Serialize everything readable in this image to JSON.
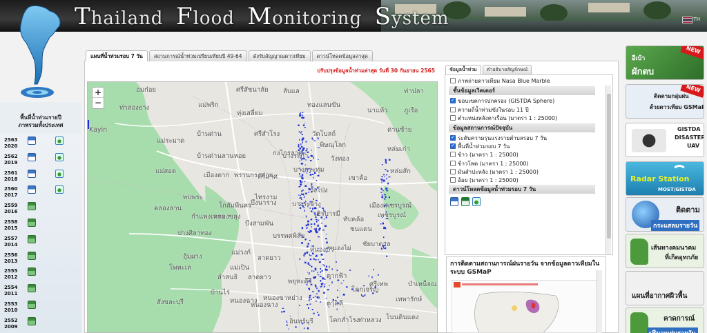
{
  "header": {
    "title_words": [
      {
        "cap": "T",
        "rest": "hailand"
      },
      {
        "cap": "F",
        "rest": "lood"
      },
      {
        "cap": "M",
        "rest": "onitoring"
      },
      {
        "cap": "S",
        "rest": "ystem"
      }
    ],
    "lang_label": "TH"
  },
  "left_panel": {
    "title_line1": "พื้นที่น้ำท่วมรายปี",
    "title_line2": "ภาพรวมทั้งประเทศ",
    "years": [
      {
        "th": "2563",
        "en": "2020",
        "icon1": "shp-icon",
        "icon2": "kmz-icon"
      },
      {
        "th": "2562",
        "en": "2019",
        "icon1": "shp-icon",
        "icon2": "kmz-icon"
      },
      {
        "th": "2561",
        "en": "2018",
        "icon1": "shp-icon",
        "icon2": "kmz-icon"
      },
      {
        "th": "2560",
        "en": "2017",
        "icon1": "shp-icon",
        "icon2": "kmz-icon"
      },
      {
        "th": "2559",
        "en": "2016",
        "icon1": "jpg-icon",
        "icon2": ""
      },
      {
        "th": "2558",
        "en": "2015",
        "icon1": "jpg-icon",
        "icon2": ""
      },
      {
        "th": "2557",
        "en": "2014",
        "icon1": "jpg-icon",
        "icon2": ""
      },
      {
        "th": "2556",
        "en": "2013",
        "icon1": "jpg-icon",
        "icon2": ""
      },
      {
        "th": "2555",
        "en": "2012",
        "icon1": "jpg-icon",
        "icon2": ""
      },
      {
        "th": "2554",
        "en": "2011",
        "icon1": "jpg-icon",
        "icon2": ""
      },
      {
        "th": "2553",
        "en": "2010",
        "icon1": "jpg-icon",
        "icon2": ""
      },
      {
        "th": "2552",
        "en": "2009",
        "icon1": "jpg-icon",
        "icon2": ""
      }
    ]
  },
  "tabs": [
    {
      "label": "แผนที่น้ำท่วมรอบ 7 วัน",
      "active": true
    },
    {
      "label": "สถานการณ์น้ำท่วมเปรียบเทียบปี 49-64",
      "active": false
    },
    {
      "label": "ดังรับสัญญาณดาวเทียม",
      "active": false
    },
    {
      "label": "ดาวน์โหลดข้อมูลล่าสุด",
      "active": false
    }
  ],
  "update_notice": "ปรับปรุงข้อมูลน้ำท่วมล่าสุด วันที่ 30 กันยายน 2565",
  "map": {
    "zoom_in": "+",
    "zoom_out": "−",
    "places": [
      "อมก๋อย",
      "ศรีสัชนาลัย",
      "ลับแล",
      "ท่าปลา",
      "แม่พริก",
      "ทองแสนขัน",
      "ท่าสองยาง",
      "ทุ่งเสลี่ยม",
      "นาแห้ว",
      "ภูเรือ",
      "บ้านด่าน",
      "ศรีสำโรง",
      "วัดโบสถ์",
      "ด่านซ้าย",
      "Kayin",
      "แม่ระมาด",
      "บ้านด่านลานหอย",
      "วังทอง",
      "พิษณุโลก",
      "หล่มเก่า",
      "กงไกรลาศ",
      "เมืองตาก",
      "คีรีมาศ",
      "บางระกำ",
      "หล่มสัก",
      "แม่สอด",
      "พรานกระต่าย",
      "เขาค้อ",
      "บางกระทุ่ม",
      "โกสัมพีนคร",
      "พบพระ",
      "ไทรงาม",
      "กำแพงเพชร",
      "วชิรบารมี",
      "บึงนาราง",
      "เมืองเพชรบูรณ์",
      "คลองลาน",
      "คลองขลุง",
      "วังโป่ง",
      "บางระจ้าง",
      "ทับคล้อ",
      "เพชรบูรณ์",
      "บึงสามพัน",
      "ปางศิลาทอง",
      "บรรพตพิสัย",
      "ชนแดน",
      "แม่วงก์",
      "ลาดยาว",
      "หนองบัว",
      "หนองไผ่",
      "อุ้มผาง",
      "แม่เปิน",
      "โพทะเล",
      "ชัยบาดาล",
      "ลำสนธิ",
      "ตากฟ้า",
      "ลาดยาว",
      "บ้านไร่",
      "พยุหะคีรี",
      "โคกเจริญ",
      "ศรีเทพ",
      "บำเหน็จณรงค์",
      "หนองฉาง",
      "หนองขาหย่าง",
      "ตาคลี",
      "เทพารักษ์",
      "สังขละบุรี",
      "หนองฉาง",
      "โคกสำโรง",
      "ท่าหลวง",
      "อินทร์บุรี",
      "โนนดินแดง"
    ]
  },
  "layer_tabs": [
    {
      "label": "ข้อมูลน้ำท่วม",
      "active": true
    },
    {
      "label": "คำอธิบายสัญลักษณ์",
      "active": false
    }
  ],
  "layers": {
    "rows": [
      {
        "label": "ภาพถ่ายดาวเทียม Nasa Blue Marble",
        "checked": false,
        "type": "check"
      },
      {
        "label": "ชั้นข้อมูลเวิคเตอร์",
        "type": "section"
      },
      {
        "label": "ขอบเขตการปกครอง (GISTDA Sphere)",
        "checked": true,
        "type": "check"
      },
      {
        "label": "ความถี่น้ำท่วมขังในรอบ 11 ปี",
        "checked": false,
        "type": "check"
      },
      {
        "label": "ตำแหน่งหลังคาเรือน (มาตรา 1 : 25000)",
        "checked": false,
        "type": "check"
      },
      {
        "label": "ข้อมูลสถานการณ์ปัจจุบัน",
        "type": "section"
      },
      {
        "label": "ระดับความรุนแรงรายตำบลรอบ 7 วัน",
        "checked": true,
        "type": "check"
      },
      {
        "label": "พื้นที่น้ำท่วมรอบ 7 วัน",
        "checked": true,
        "type": "check"
      },
      {
        "label": "ข้าว (มาตรา 1 : 25000)",
        "checked": false,
        "type": "check"
      },
      {
        "label": "ข้าวโพด (มาตรา 1 : 25000)",
        "checked": false,
        "type": "check"
      },
      {
        "label": "มันสำปะหลัง (มาตรา 1 : 25000)",
        "checked": false,
        "type": "check"
      },
      {
        "label": "อ้อย (มาตรา 1 : 25000)",
        "checked": false,
        "type": "check"
      },
      {
        "label": "ดาวน์โหลดข้อมูลน้ำท่วมรอบ 7 วัน",
        "type": "section"
      }
    ]
  },
  "gsmap": {
    "title": "การติดตามสถานการณ์ฝนรายวัน จากข้อมูลดาวเทียมในระบบ GSMaP"
  },
  "banners": [
    {
      "line1": "อีเบ้า",
      "line2": "ผักตบ",
      "new": true,
      "label": "ผักตบ",
      "bg": "#3e8d3a"
    },
    {
      "line1": "ติดตามกลุ่มฝน",
      "line2": "ด้วยดาวเทียม GSMaP",
      "new": true,
      "bg": "#e7eef6"
    },
    {
      "line1": "GISTDA",
      "line2": "DISASTER",
      "line3": "UAV",
      "new": false,
      "bg": "#ffffff"
    },
    {
      "line1": "Radar Station",
      "line2": "MOST/GISTDA",
      "new": false,
      "bg": "#2f9fc9"
    },
    {
      "line1": "ติดตาม",
      "line2": "กระแสลมรายวัน",
      "new": false,
      "bg": "#e9eef5"
    },
    {
      "line1": "เส้นทางคมนาคม",
      "line2": "ที่เกิดอุทกภัย",
      "new": false,
      "bg": "#eaf2e4"
    },
    {
      "line1": "แผนที่อากาศผิวพื้น",
      "line2": "",
      "new": false,
      "bg": "#f0f0f0"
    },
    {
      "line1": "คาดการณ์",
      "line2": "ปริมาณฝนรายวัน",
      "new": false,
      "bg": "#eaf2e4"
    }
  ],
  "colors": {
    "update_text": "#d21a1a",
    "flood": "#1a2fd6",
    "forest": "#9fd7a5",
    "road": "#ffffff"
  }
}
